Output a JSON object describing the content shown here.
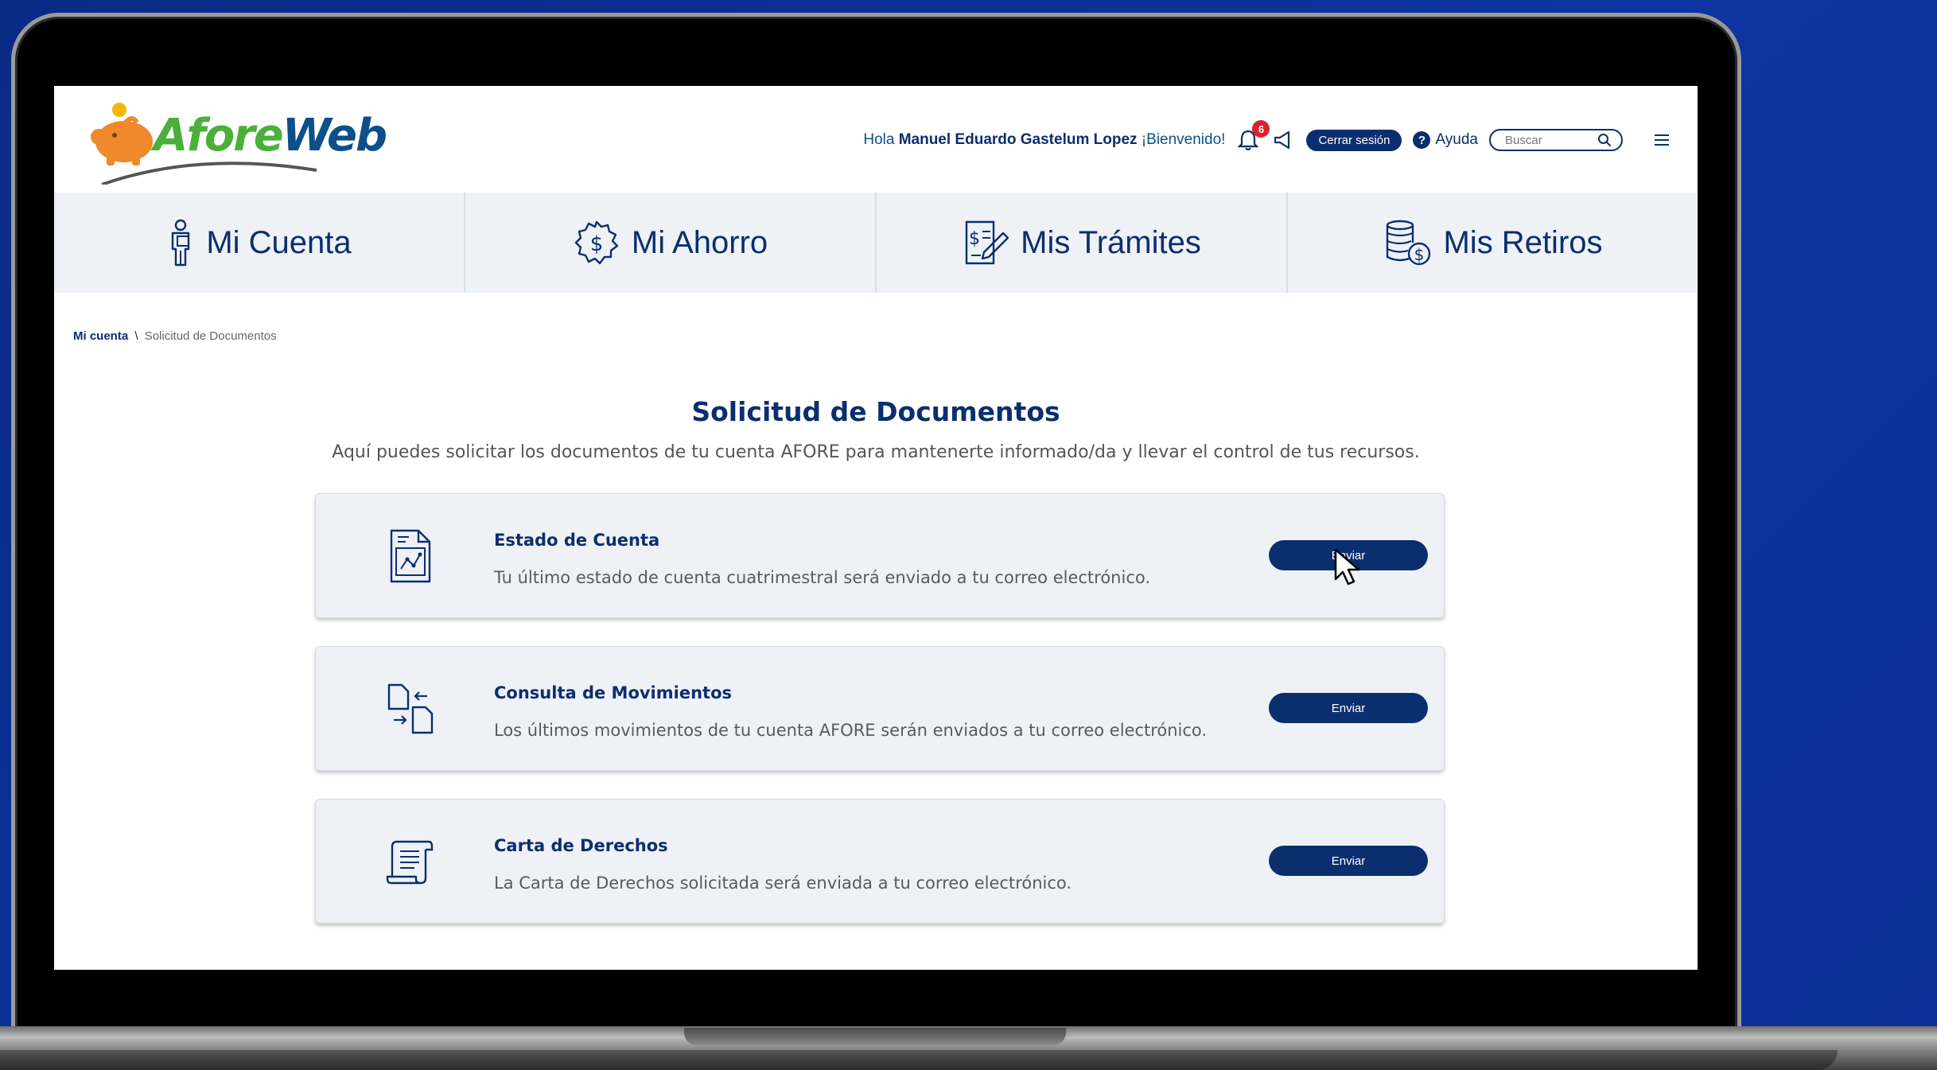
{
  "header": {
    "logo_text_a": "Afore",
    "logo_text_b": "Web",
    "greeting_prefix": "Hola",
    "user_name": "Manuel Eduardo Gastelum Lopez",
    "greeting_suffix": "¡Bienvenido!",
    "notification_count": "6",
    "logout_label": "Cerrar sesión",
    "help_label": "Ayuda",
    "help_icon_glyph": "?",
    "search_placeholder": "Buscar"
  },
  "nav": {
    "items": [
      {
        "label": "Mi Cuenta",
        "icon": "person-document-icon"
      },
      {
        "label": "Mi Ahorro",
        "icon": "money-circle-icon"
      },
      {
        "label": "Mis Trámites",
        "icon": "document-pen-icon"
      },
      {
        "label": "Mis Retiros",
        "icon": "coins-stack-icon"
      }
    ]
  },
  "breadcrumb": {
    "root": "Mi cuenta",
    "separator": "\\",
    "current": "Solicitud de Documentos"
  },
  "main": {
    "title": "Solicitud de Documentos",
    "subtitle": "Aquí puedes solicitar los documentos de tu cuenta AFORE para mantenerte informado/da y llevar el control de tus recursos.",
    "cards": [
      {
        "title": "Estado de Cuenta",
        "description": "Tu último estado de cuenta cuatrimestral será enviado a tu correo electrónico.",
        "button_label": "Enviar",
        "icon": "statement-chart-icon"
      },
      {
        "title": "Consulta de Movimientos",
        "description": "Los últimos movimientos de tu cuenta AFORE serán enviados a tu correo electrónico.",
        "button_label": "Enviar",
        "icon": "document-transfer-icon"
      },
      {
        "title": "Carta de Derechos",
        "description": "La Carta de Derechos solicitada será enviada a tu correo electrónico.",
        "button_label": "Enviar",
        "icon": "scroll-icon"
      }
    ]
  },
  "colors": {
    "primary": "#0b2e6e",
    "background_outer": "#0b2c8c",
    "nav_background": "#eef2f6",
    "badge": "#d8232a",
    "logo_green": "#4caf3a",
    "logo_blue": "#0d4f8a"
  }
}
